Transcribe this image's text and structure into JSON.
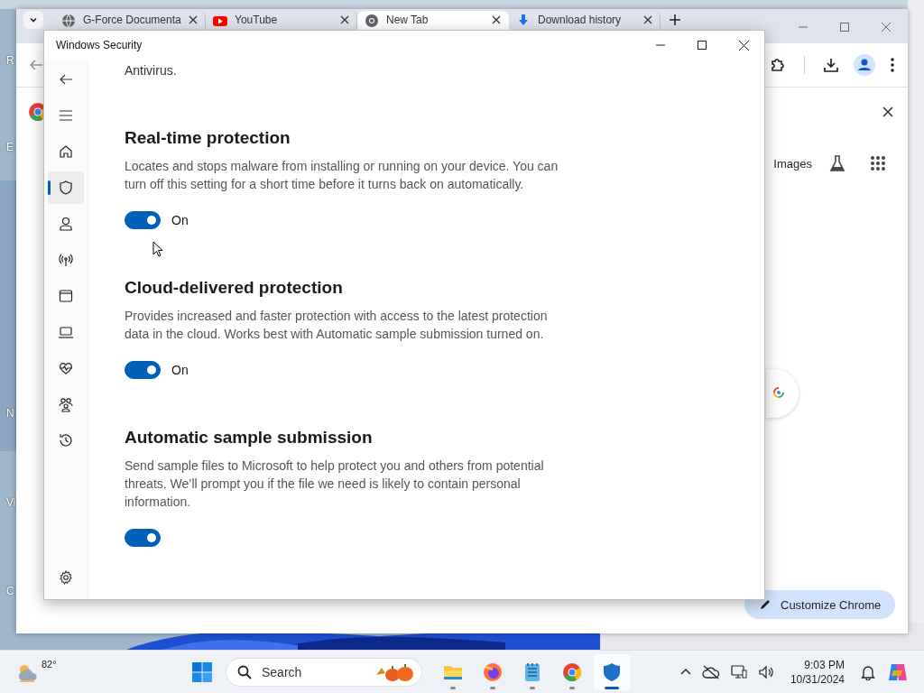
{
  "desktop": {
    "icon_labels": [
      "R",
      "E",
      "N",
      "Vi",
      "C"
    ]
  },
  "browser": {
    "tabs": [
      {
        "kind": "globe",
        "title": "G-Force Documenta",
        "selected": false
      },
      {
        "kind": "youtube",
        "title": "YouTube",
        "selected": false
      },
      {
        "kind": "chrome",
        "title": "New Tab",
        "selected": true
      },
      {
        "kind": "download",
        "title": "Download history",
        "selected": false
      }
    ],
    "page": {
      "images_link": "Images",
      "customize_button": "Customize Chrome"
    }
  },
  "security": {
    "title": "Windows Security",
    "nav": [
      {
        "kind": "home",
        "selected": false
      },
      {
        "kind": "shield",
        "selected": true
      },
      {
        "kind": "person",
        "selected": false
      },
      {
        "kind": "antenna",
        "selected": false
      },
      {
        "kind": "window",
        "selected": false
      },
      {
        "kind": "laptop",
        "selected": false
      },
      {
        "kind": "heart",
        "selected": false
      },
      {
        "kind": "family",
        "selected": false
      },
      {
        "kind": "history",
        "selected": false
      }
    ],
    "intro_fragment": "Antivirus.",
    "sections": [
      {
        "heading": "Real-time protection",
        "description": "Locates and stops malware from installing or running on your device. You can turn off this setting for a short time before it turns back on automatically.",
        "toggle": {
          "on": true,
          "label": "On"
        }
      },
      {
        "heading": "Cloud-delivered protection",
        "description": "Provides increased and faster protection with access to the latest protection data in the cloud. Works best with Automatic sample submission turned on.",
        "toggle": {
          "on": true,
          "label": "On"
        }
      },
      {
        "heading": "Automatic sample submission",
        "description": "Send sample files to Microsoft to help protect you and others from potential threats. We’ll prompt you if the file we need is likely to contain personal information.",
        "toggle": {
          "on": true
        }
      }
    ]
  },
  "taskbar": {
    "weather": {
      "temperature": "82°"
    },
    "search": {
      "placeholder": "Search"
    },
    "apps": [
      {
        "kind": "explorer",
        "running": true,
        "selected": false
      },
      {
        "kind": "firefox",
        "running": true,
        "selected": false
      },
      {
        "kind": "notepad",
        "running": true,
        "selected": false
      },
      {
        "kind": "chrome",
        "running": true,
        "selected": false
      },
      {
        "kind": "defender",
        "running": true,
        "selected": true
      }
    ],
    "clock": {
      "time": "9:03 PM",
      "date": "10/31/2024"
    }
  }
}
